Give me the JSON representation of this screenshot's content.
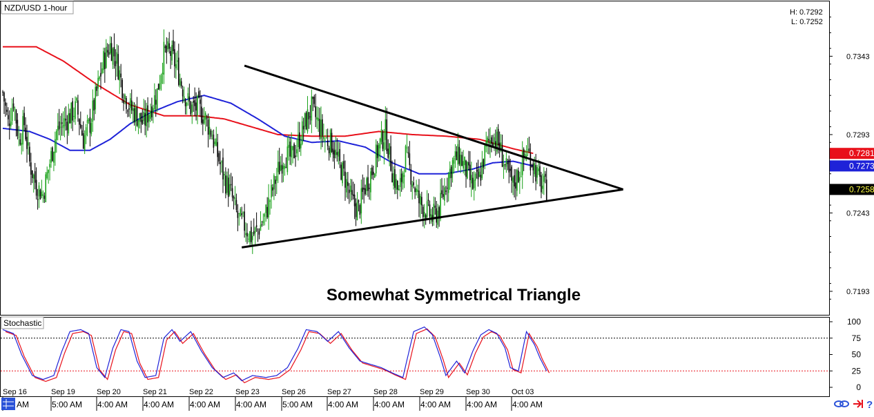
{
  "title": "NZD/USD 1-hour",
  "high_label": "H: 0.7292",
  "low_label": "L: 0.7252",
  "annotation": "Somewhat Symmetrical Triangle",
  "indicator_label": "Stochastic",
  "price_ticks": [
    "0.7343",
    "0.7293",
    "0.7243",
    "0.7193"
  ],
  "stoch_ticks": [
    "100",
    "75",
    "50",
    "25",
    "0"
  ],
  "price_tags": [
    {
      "label": "0.7281",
      "value": 0.7281,
      "color": "#e8101a"
    },
    {
      "label": "0.7273",
      "value": 0.7273,
      "color": "#1e22d8"
    },
    {
      "label": "0.7258",
      "value": 0.7258,
      "color": "#000000"
    }
  ],
  "time_labels": [
    {
      "top": "Sep 16",
      "bottom": "AM"
    },
    {
      "top": "Sep 19",
      "bottom": "5:00 AM"
    },
    {
      "top": "Sep 20",
      "bottom": "4:00 AM"
    },
    {
      "top": "Sep 21",
      "bottom": "4:00 AM"
    },
    {
      "top": "Sep 22",
      "bottom": "4:00 AM"
    },
    {
      "top": "Sep 23",
      "bottom": "4:00 AM"
    },
    {
      "top": "Sep 26",
      "bottom": "5:00 AM"
    },
    {
      "top": "Sep 27",
      "bottom": "4:00 AM"
    },
    {
      "top": "Sep 28",
      "bottom": "4:00 AM"
    },
    {
      "top": "Sep 29",
      "bottom": "4:00 AM"
    },
    {
      "top": "Sep 30",
      "bottom": "4:00 AM"
    },
    {
      "top": "Oct 03",
      "bottom": "4:00 AM"
    }
  ],
  "colors": {
    "bull": "#16a016",
    "bear": "#000000",
    "ma_red": "#e8101a",
    "ma_blue": "#1e22d8",
    "trendline": "#000000",
    "stoch_k": "#1e22d8",
    "stoch_d": "#e8101a",
    "level_75": "#000000",
    "level_25": "#e8101a"
  },
  "icons": [
    "grid-icon",
    "link-icon",
    "arrow-icon",
    "help-icon"
  ],
  "chart_data": {
    "type": "line",
    "subtype": "candlestick with moving averages and stochastic oscillator",
    "price_axis": {
      "min": 0.7178,
      "max": 0.7378,
      "ticks": [
        0.7343,
        0.7293,
        0.7243,
        0.7193
      ]
    },
    "trendlines": {
      "upper": [
        {
          "bar": 180,
          "price": 0.7337
        },
        {
          "bar": 462,
          "price": 0.7258
        }
      ],
      "lower": [
        {
          "bar": 178,
          "price": 0.7221
        },
        {
          "bar": 462,
          "price": 0.7258
        }
      ]
    },
    "close_path": [
      [
        0,
        0.732
      ],
      [
        4,
        0.73
      ],
      [
        8,
        0.7315
      ],
      [
        12,
        0.729
      ],
      [
        16,
        0.73
      ],
      [
        20,
        0.7275
      ],
      [
        25,
        0.726
      ],
      [
        30,
        0.7255
      ],
      [
        35,
        0.7275
      ],
      [
        40,
        0.7295
      ],
      [
        45,
        0.73
      ],
      [
        50,
        0.7305
      ],
      [
        55,
        0.731
      ],
      [
        60,
        0.729
      ],
      [
        65,
        0.73
      ],
      [
        70,
        0.732
      ],
      [
        75,
        0.734
      ],
      [
        80,
        0.735
      ],
      [
        85,
        0.734
      ],
      [
        90,
        0.732
      ],
      [
        95,
        0.731
      ],
      [
        100,
        0.7305
      ],
      [
        105,
        0.73
      ],
      [
        110,
        0.731
      ],
      [
        115,
        0.732
      ],
      [
        120,
        0.7345
      ],
      [
        125,
        0.7345
      ],
      [
        130,
        0.7335
      ],
      [
        135,
        0.732
      ],
      [
        140,
        0.731
      ],
      [
        145,
        0.731
      ],
      [
        150,
        0.7305
      ],
      [
        155,
        0.7295
      ],
      [
        160,
        0.728
      ],
      [
        165,
        0.7265
      ],
      [
        170,
        0.7255
      ],
      [
        175,
        0.724
      ],
      [
        180,
        0.7235
      ],
      [
        185,
        0.7228
      ],
      [
        190,
        0.7232
      ],
      [
        195,
        0.724
      ],
      [
        200,
        0.7255
      ],
      [
        205,
        0.727
      ],
      [
        210,
        0.728
      ],
      [
        215,
        0.7278
      ],
      [
        220,
        0.7288
      ],
      [
        225,
        0.73
      ],
      [
        230,
        0.731
      ],
      [
        235,
        0.73
      ],
      [
        240,
        0.729
      ],
      [
        245,
        0.7288
      ],
      [
        250,
        0.7275
      ],
      [
        255,
        0.7265
      ],
      [
        260,
        0.725
      ],
      [
        265,
        0.7245
      ],
      [
        270,
        0.726
      ],
      [
        275,
        0.727
      ],
      [
        280,
        0.7285
      ],
      [
        285,
        0.7295
      ],
      [
        290,
        0.727
      ],
      [
        295,
        0.7255
      ],
      [
        300,
        0.728
      ],
      [
        305,
        0.7265
      ],
      [
        310,
        0.725
      ],
      [
        315,
        0.7245
      ],
      [
        320,
        0.724
      ],
      [
        325,
        0.7245
      ],
      [
        330,
        0.7262
      ],
      [
        335,
        0.7275
      ],
      [
        340,
        0.728
      ],
      [
        345,
        0.727
      ],
      [
        350,
        0.726
      ],
      [
        355,
        0.7265
      ],
      [
        360,
        0.7285
      ],
      [
        365,
        0.7293
      ],
      [
        370,
        0.7285
      ],
      [
        375,
        0.727
      ],
      [
        380,
        0.726
      ],
      [
        385,
        0.727
      ],
      [
        390,
        0.7283
      ],
      [
        395,
        0.7275
      ],
      [
        400,
        0.7262
      ],
      [
        405,
        0.7258
      ]
    ],
    "ma_red_path": [
      [
        0,
        0.7349
      ],
      [
        25,
        0.7349
      ],
      [
        45,
        0.734
      ],
      [
        70,
        0.7325
      ],
      [
        95,
        0.7312
      ],
      [
        120,
        0.7305
      ],
      [
        145,
        0.7305
      ],
      [
        165,
        0.7303
      ],
      [
        185,
        0.7298
      ],
      [
        205,
        0.7293
      ],
      [
        230,
        0.7292
      ],
      [
        255,
        0.7292
      ],
      [
        280,
        0.7295
      ],
      [
        305,
        0.7293
      ],
      [
        330,
        0.7292
      ],
      [
        355,
        0.729
      ],
      [
        380,
        0.7284
      ],
      [
        395,
        0.7281
      ]
    ],
    "ma_blue_path": [
      [
        0,
        0.7297
      ],
      [
        20,
        0.7295
      ],
      [
        35,
        0.729
      ],
      [
        50,
        0.7283
      ],
      [
        65,
        0.7283
      ],
      [
        80,
        0.729
      ],
      [
        95,
        0.73
      ],
      [
        110,
        0.7307
      ],
      [
        130,
        0.7314
      ],
      [
        150,
        0.7318
      ],
      [
        170,
        0.7313
      ],
      [
        190,
        0.7303
      ],
      [
        210,
        0.7292
      ],
      [
        230,
        0.7288
      ],
      [
        250,
        0.7289
      ],
      [
        270,
        0.7285
      ],
      [
        290,
        0.7275
      ],
      [
        310,
        0.7268
      ],
      [
        330,
        0.7268
      ],
      [
        350,
        0.7271
      ],
      [
        365,
        0.7275
      ],
      [
        380,
        0.7276
      ],
      [
        395,
        0.7273
      ]
    ],
    "stochastic": {
      "levels": [
        75,
        25
      ],
      "axis": {
        "min": 0,
        "max": 100,
        "ticks": [
          100,
          75,
          50,
          25,
          0
        ]
      },
      "k_path": [
        [
          0,
          88
        ],
        [
          8,
          82
        ],
        [
          14,
          50
        ],
        [
          22,
          18
        ],
        [
          30,
          12
        ],
        [
          38,
          18
        ],
        [
          44,
          55
        ],
        [
          50,
          85
        ],
        [
          58,
          88
        ],
        [
          64,
          82
        ],
        [
          70,
          30
        ],
        [
          76,
          15
        ],
        [
          82,
          60
        ],
        [
          88,
          88
        ],
        [
          94,
          85
        ],
        [
          100,
          40
        ],
        [
          106,
          15
        ],
        [
          114,
          18
        ],
        [
          120,
          75
        ],
        [
          126,
          88
        ],
        [
          132,
          70
        ],
        [
          140,
          85
        ],
        [
          148,
          55
        ],
        [
          156,
          30
        ],
        [
          164,
          15
        ],
        [
          172,
          22
        ],
        [
          178,
          10
        ],
        [
          186,
          18
        ],
        [
          196,
          15
        ],
        [
          204,
          18
        ],
        [
          212,
          30
        ],
        [
          220,
          60
        ],
        [
          226,
          88
        ],
        [
          234,
          85
        ],
        [
          242,
          70
        ],
        [
          250,
          85
        ],
        [
          258,
          60
        ],
        [
          266,
          40
        ],
        [
          274,
          35
        ],
        [
          282,
          30
        ],
        [
          290,
          22
        ],
        [
          298,
          15
        ],
        [
          306,
          85
        ],
        [
          314,
          92
        ],
        [
          320,
          80
        ],
        [
          326,
          45
        ],
        [
          330,
          18
        ],
        [
          338,
          40
        ],
        [
          344,
          22
        ],
        [
          350,
          55
        ],
        [
          356,
          80
        ],
        [
          362,
          88
        ],
        [
          368,
          82
        ],
        [
          374,
          60
        ],
        [
          378,
          30
        ],
        [
          384,
          25
        ],
        [
          390,
          85
        ],
        [
          396,
          65
        ],
        [
          400,
          45
        ],
        [
          405,
          25
        ]
      ]
    }
  }
}
